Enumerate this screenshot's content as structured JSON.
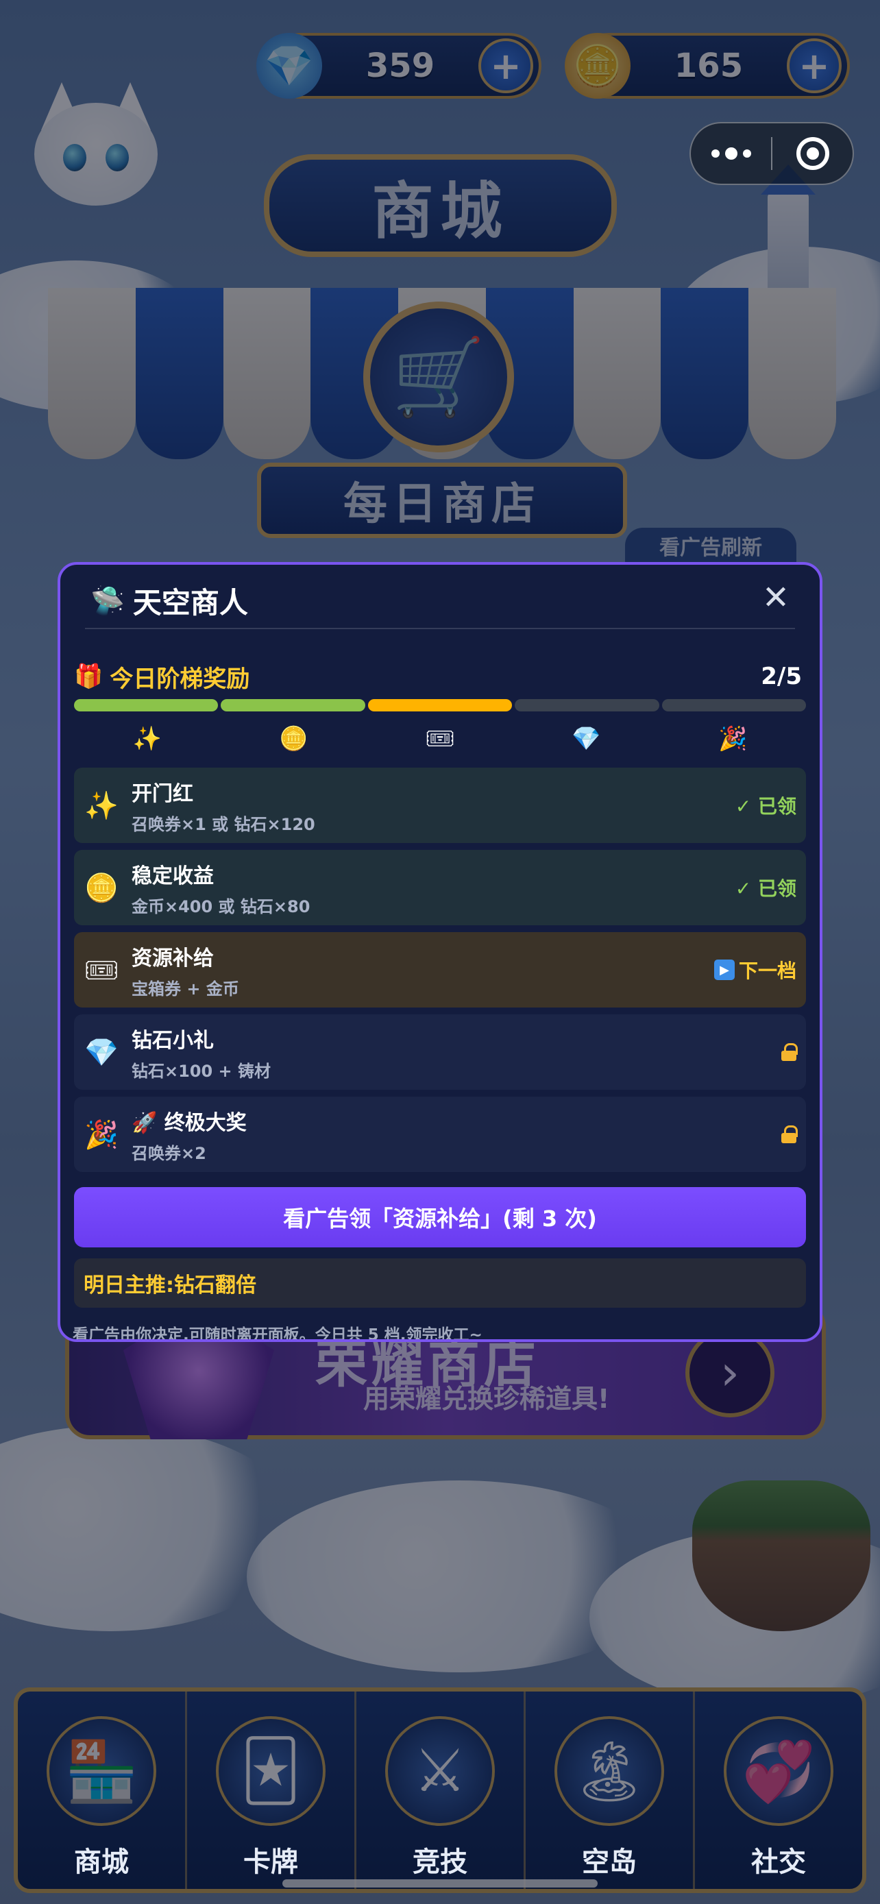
{
  "topbar": {
    "gems": "359",
    "coins": "165",
    "plus_label": "+",
    "gem_icon": "gem-icon",
    "coin_icon": "coin-icon"
  },
  "background": {
    "shop_title": "商城",
    "daily_shop": "每日商店",
    "refresh_tab": "看广告刷新",
    "honor_title": "荣耀商店",
    "honor_subtitle": "用荣耀兑换珍稀道具!",
    "honor_arrow": "›"
  },
  "panel": {
    "title": "天空商人",
    "title_icon": "ufo-icon",
    "close_label": "✕",
    "ladder_title": "今日阶梯奖励",
    "ladder_count": "2/5",
    "progress": {
      "claimed": 2,
      "current": 1,
      "total": 5,
      "colors": {
        "claimed": "#8bc34a",
        "current": "#ffb300",
        "locked": "#3a424f"
      }
    },
    "tiers": [
      {
        "icon": "✨",
        "icon_name": "sparkles-icon",
        "name": "开门红",
        "desc": "召唤券×1 或 钻石×120",
        "status": "✓ 已领",
        "state": "claimed"
      },
      {
        "icon": "🪙",
        "icon_name": "coin-icon",
        "name": "稳定收益",
        "desc": "金币×400 或 钻石×80",
        "status": "✓ 已领",
        "state": "claimed"
      },
      {
        "icon": "🎟",
        "icon_name": "ticket-icon",
        "name": "资源补给",
        "desc": "宝箱券 + 金币",
        "status": "下一档",
        "state": "next"
      },
      {
        "icon": "💎",
        "icon_name": "diamond-icon",
        "name": "钻石小礼",
        "desc": "钻石×100 + 铸材",
        "status": "",
        "state": "locked"
      },
      {
        "icon": "🎉",
        "icon_name": "party-popper-icon",
        "name": "🚀 终极大奖",
        "desc": "召唤券×2",
        "status": "",
        "state": "locked"
      }
    ],
    "cta_label": "看广告领「资源补给」(剩 3 次)",
    "tomorrow": "明日主推:钻石翻倍",
    "footnote": "看广告由你决定,可随时离开面板。今日共 5 档,领完收工~"
  },
  "bottom_nav": [
    {
      "label": "商城",
      "icon": "🏪",
      "icon_name": "shop-icon"
    },
    {
      "label": "卡牌",
      "icon": "🃏",
      "icon_name": "card-icon"
    },
    {
      "label": "竞技",
      "icon": "⚔",
      "icon_name": "crossed-swords-icon"
    },
    {
      "label": "空岛",
      "icon": "🏝",
      "icon_name": "sky-island-icon"
    },
    {
      "label": "社交",
      "icon": "💞",
      "icon_name": "social-icon"
    }
  ]
}
